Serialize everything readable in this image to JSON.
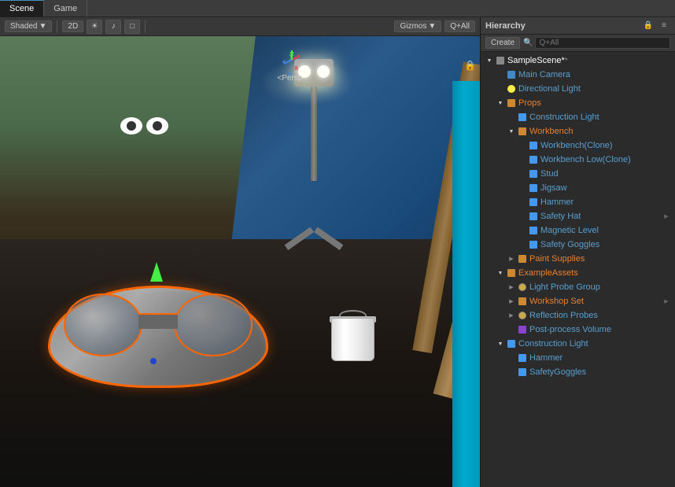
{
  "tabs": {
    "scene": "Scene",
    "game": "Game"
  },
  "scene_toolbar": {
    "shading": "Shaded",
    "view_2d": "2D",
    "gizmos": "Gizmos",
    "layers": "Q+All",
    "persp": "<Persp"
  },
  "hierarchy": {
    "title": "Hierarchy",
    "create_btn": "Create",
    "search_placeholder": "Q+All",
    "tree": [
      {
        "id": "sample-scene",
        "label": "SampleScene*",
        "indent": 0,
        "icon": "scene",
        "arrow": "open",
        "class": "white modified",
        "has_expand": false
      },
      {
        "id": "main-camera",
        "label": "Main Camera",
        "indent": 1,
        "icon": "camera",
        "arrow": "empty",
        "class": "blue",
        "has_expand": false
      },
      {
        "id": "directional-light",
        "label": "Directional Light",
        "indent": 1,
        "icon": "light",
        "arrow": "empty",
        "class": "blue",
        "has_expand": false
      },
      {
        "id": "props",
        "label": "Props",
        "indent": 1,
        "icon": "folder",
        "arrow": "open",
        "class": "orange",
        "has_expand": false
      },
      {
        "id": "construction-light-1",
        "label": "Construction Light",
        "indent": 2,
        "icon": "mesh",
        "arrow": "empty",
        "class": "blue",
        "has_expand": false
      },
      {
        "id": "workbench",
        "label": "Workbench",
        "indent": 2,
        "icon": "folder",
        "arrow": "open",
        "class": "orange",
        "has_expand": false
      },
      {
        "id": "workbench-clone",
        "label": "Workbench(Clone)",
        "indent": 3,
        "icon": "mesh",
        "arrow": "empty",
        "class": "blue",
        "has_expand": false
      },
      {
        "id": "workbench-low-clone",
        "label": "Workbench Low(Clone)",
        "indent": 3,
        "icon": "mesh",
        "arrow": "empty",
        "class": "blue",
        "has_expand": false
      },
      {
        "id": "stud",
        "label": "Stud",
        "indent": 3,
        "icon": "mesh",
        "arrow": "empty",
        "class": "blue",
        "has_expand": false
      },
      {
        "id": "jigsaw",
        "label": "Jigsaw",
        "indent": 3,
        "icon": "mesh",
        "arrow": "empty",
        "class": "blue",
        "has_expand": false
      },
      {
        "id": "hammer-1",
        "label": "Hammer",
        "indent": 3,
        "icon": "mesh",
        "arrow": "empty",
        "class": "blue",
        "has_expand": false
      },
      {
        "id": "safety-hat",
        "label": "Safety Hat",
        "indent": 3,
        "icon": "mesh",
        "arrow": "empty",
        "class": "blue",
        "has_expand": true
      },
      {
        "id": "magnetic-level",
        "label": "Magnetic Level",
        "indent": 3,
        "icon": "mesh",
        "arrow": "empty",
        "class": "blue",
        "has_expand": false
      },
      {
        "id": "safety-goggles-1",
        "label": "Safety Goggles",
        "indent": 3,
        "icon": "mesh",
        "arrow": "empty",
        "class": "blue",
        "has_expand": false
      },
      {
        "id": "paint-supplies",
        "label": "Paint Supplies",
        "indent": 2,
        "icon": "folder",
        "arrow": "closed",
        "class": "orange",
        "has_expand": false
      },
      {
        "id": "example-assets",
        "label": "ExampleAssets",
        "indent": 1,
        "icon": "folder",
        "arrow": "open",
        "class": "orange",
        "has_expand": false
      },
      {
        "id": "light-probe-group",
        "label": "Light Probe Group",
        "indent": 2,
        "icon": "probe",
        "arrow": "closed",
        "class": "blue",
        "has_expand": false
      },
      {
        "id": "workshop-set",
        "label": "Workshop Set",
        "indent": 2,
        "icon": "folder",
        "arrow": "closed",
        "class": "orange",
        "has_expand": true
      },
      {
        "id": "reflection-probes",
        "label": "Reflection Probes",
        "indent": 2,
        "icon": "probe",
        "arrow": "closed",
        "class": "blue",
        "has_expand": false
      },
      {
        "id": "post-process-volume",
        "label": "Post-process Volume",
        "indent": 2,
        "icon": "volume",
        "arrow": "empty",
        "class": "blue",
        "has_expand": false
      },
      {
        "id": "construction-light-2",
        "label": "Construction Light",
        "indent": 1,
        "icon": "mesh",
        "arrow": "open",
        "class": "blue",
        "has_expand": false
      },
      {
        "id": "hammer-2",
        "label": "Hammer",
        "indent": 2,
        "icon": "mesh",
        "arrow": "empty",
        "class": "blue",
        "has_expand": false
      },
      {
        "id": "safety-goggles-2",
        "label": "SafetyGoggles",
        "indent": 2,
        "icon": "mesh",
        "arrow": "empty",
        "class": "blue",
        "has_expand": false
      }
    ]
  }
}
